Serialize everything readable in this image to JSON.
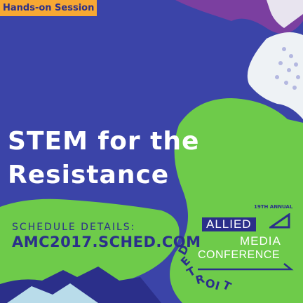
{
  "badge": {
    "label": "Hands-on Session"
  },
  "title": {
    "line1": "STEM for the",
    "line2": "Resistance"
  },
  "schedule": {
    "label": "SCHEDULE DETAILS:",
    "url": "AMC2017.SCHED.COM"
  },
  "conference": {
    "annual": "19TH ANNUAL",
    "allied": "ALLIED",
    "media": "MEDIA",
    "conference": "CONFERENCE",
    "city_letters": [
      "D",
      "E",
      "T",
      "R",
      "O",
      "I",
      "T"
    ]
  },
  "colors": {
    "background": "#3b44a8",
    "green": "#6ecb4a",
    "accent": "#f7a833",
    "navy": "#2b2f8a",
    "purple": "#7b3fa0"
  }
}
